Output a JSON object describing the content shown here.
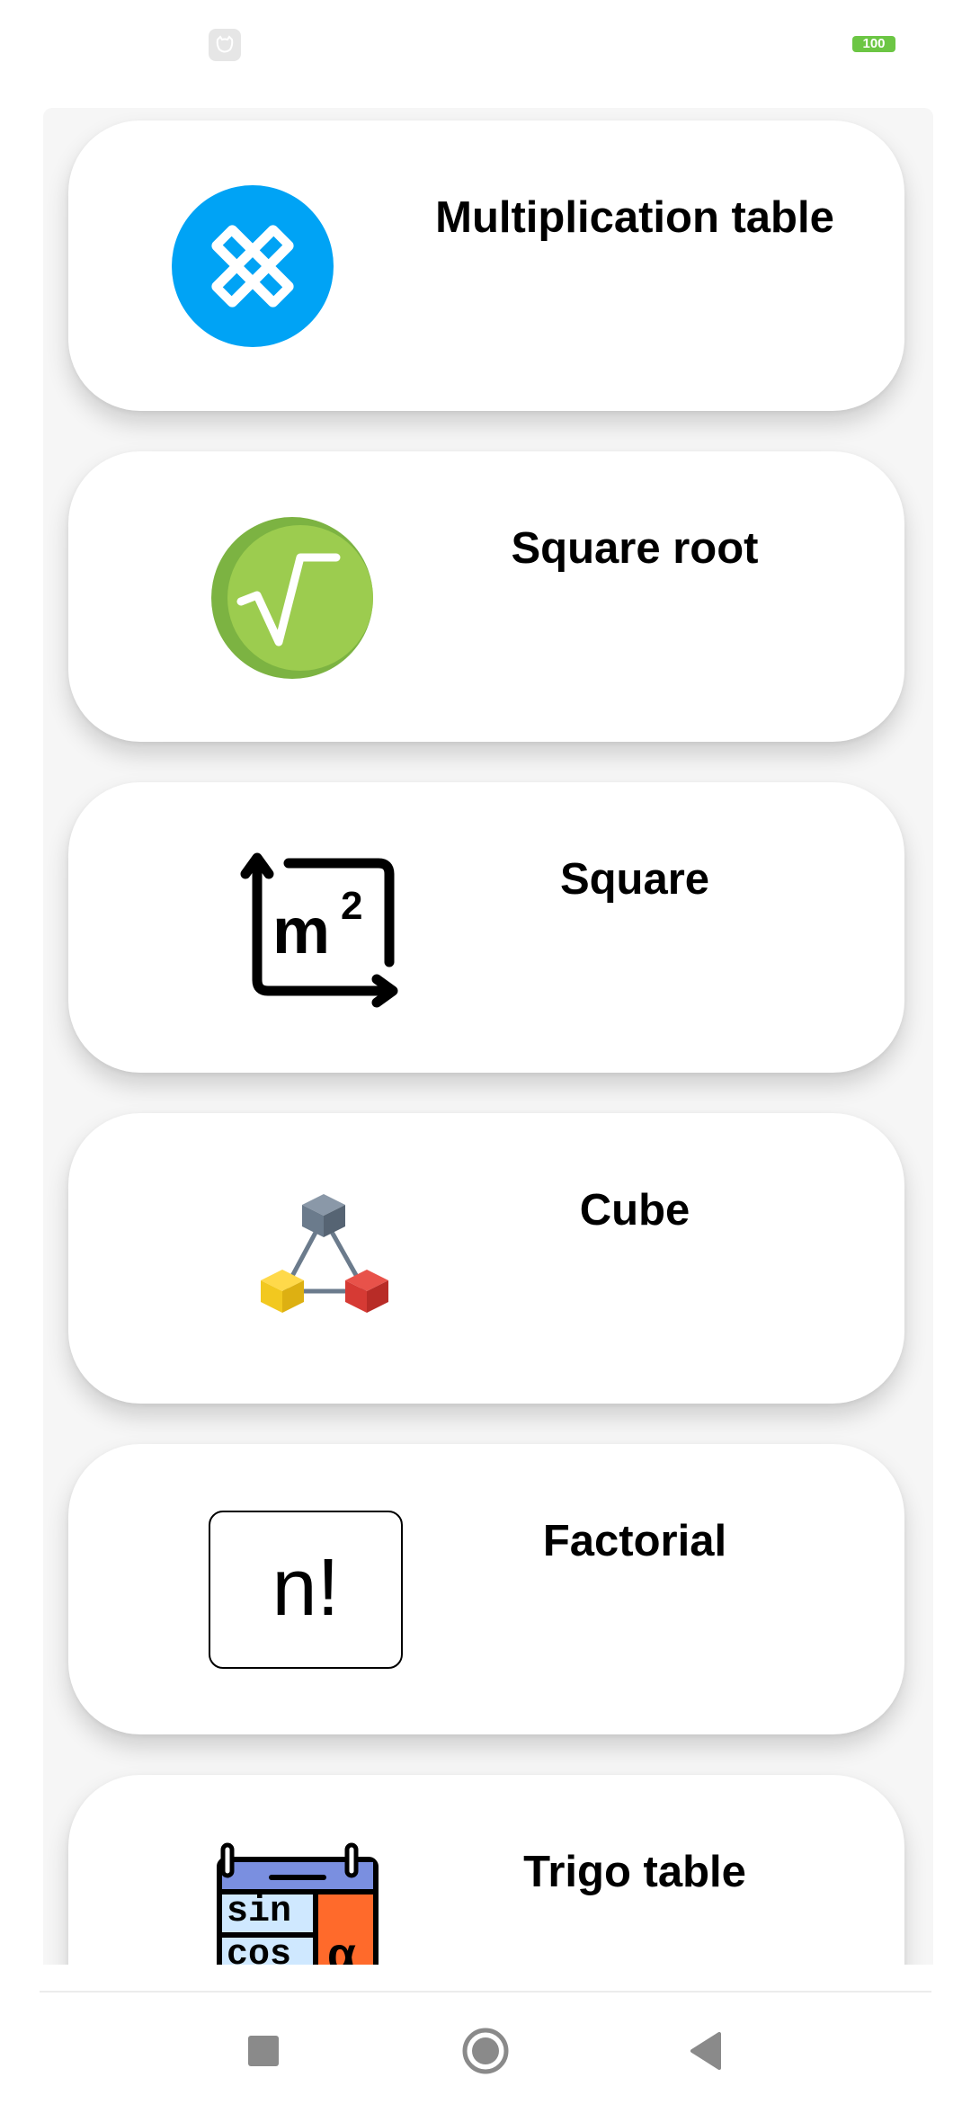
{
  "status_bar": {
    "app_icon": "cat-app-icon",
    "battery_level": "100",
    "battery_color": "#6cc644"
  },
  "cards": [
    {
      "title": "Multiplication table",
      "icon": "multiplication-icon"
    },
    {
      "title": "Square root",
      "icon": "square-root-icon"
    },
    {
      "title": "Square",
      "icon": "square-m2-icon"
    },
    {
      "title": "Cube",
      "icon": "cube-icon"
    },
    {
      "title": "Factorial",
      "icon": "factorial-icon",
      "icon_text": "n!"
    },
    {
      "title": "Trigo table",
      "icon": "trigo-table-icon",
      "icon_text_1": "sin",
      "icon_text_2": "cos",
      "icon_text_3": "α"
    }
  ],
  "nav_bar": {
    "recents": "square-nav-icon",
    "home": "circle-home-icon",
    "back": "triangle-back-icon"
  },
  "colors": {
    "multiplication_blue": "#00a3f5",
    "sqrt_green": "#8fc744",
    "cube_grey": "#6b7b8c",
    "cube_yellow": "#f2c81f",
    "cube_red": "#d63a34",
    "trigo_blue": "#7a8fe0",
    "trigo_orange": "#ff6a2b"
  }
}
